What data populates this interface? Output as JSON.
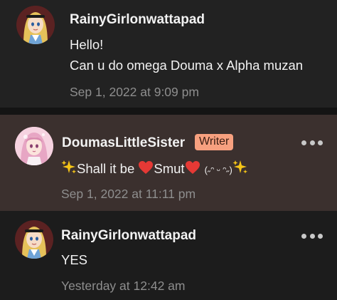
{
  "comments": [
    {
      "author": "RainyGirlonwattapad",
      "lines": [
        "Hello!",
        "Can u do omega Douma x Alpha muzan"
      ],
      "timestamp": "Sep 1, 2022 at 9:09 pm",
      "avatar_icon": "blonde-girl-avatar-icon"
    },
    {
      "author": "DoumasLittleSister",
      "badge": "Writer",
      "text_parts": [
        "Shall it be ",
        "Smut",
        "(˶ᵔ ᵕ ᵔ˶)"
      ],
      "icons": [
        "sparkles-icon",
        "heart-icon",
        "heart-icon",
        "sparkles-icon"
      ],
      "timestamp": "Sep 1, 2022 at 11:11 pm",
      "avatar_icon": "pink-anime-girl-avatar-icon"
    },
    {
      "author": "RainyGirlonwattapad",
      "lines": [
        "YES"
      ],
      "timestamp": "Yesterday at 12:42 am",
      "avatar_icon": "blonde-girl-avatar-icon"
    }
  ],
  "colors": {
    "highlight_bg": "#3b302e",
    "badge_bg": "#f7a07f",
    "timestamp": "#8e8e8e",
    "heart": "#e53935",
    "sparkle": "#f5c518"
  }
}
